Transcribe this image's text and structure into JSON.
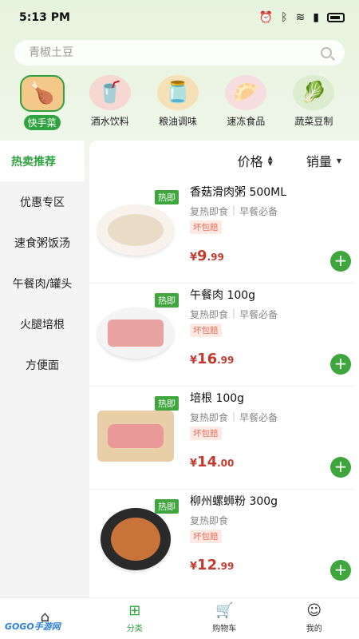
{
  "status_bar": {
    "time": "5:13 PM"
  },
  "search": {
    "placeholder": "青椒土豆"
  },
  "categories": [
    {
      "label": "快手菜",
      "icon": "fried-food-icon"
    },
    {
      "label": "酒水饮料",
      "icon": "cola-icon"
    },
    {
      "label": "粮油调味",
      "icon": "oil-bottle-icon"
    },
    {
      "label": "速冻食品",
      "icon": "dumpling-icon"
    },
    {
      "label": "蔬菜豆制",
      "icon": "vegetable-icon"
    }
  ],
  "sidebar": {
    "items": [
      {
        "label": "热卖推荐"
      },
      {
        "label": "优惠专区"
      },
      {
        "label": "速食粥饭汤"
      },
      {
        "label": "午餐肉/罐头"
      },
      {
        "label": "火腿培根"
      },
      {
        "label": "方便面"
      }
    ]
  },
  "sort": {
    "price_label": "价格",
    "sales_label": "销量"
  },
  "products": [
    {
      "name": "香菇滑肉粥 500ML",
      "hot": "热即",
      "tag1": "复热即食",
      "tag2": "早餐必备",
      "badge": "坏包赔",
      "currency": "¥",
      "price_int": "9",
      "price_dec": ".99"
    },
    {
      "name": "午餐肉 100g",
      "hot": "热即",
      "tag1": "复热即食",
      "tag2": "早餐必备",
      "badge": "坏包赔",
      "currency": "¥",
      "price_int": "16",
      "price_dec": ".99"
    },
    {
      "name": "培根 100g",
      "hot": "热即",
      "tag1": "复热即食",
      "tag2": "早餐必备",
      "badge": "坏包赔",
      "currency": "¥",
      "price_int": "14",
      "price_dec": ".00"
    },
    {
      "name": "柳州螺蛳粉 300g",
      "hot": "热即",
      "tag1": "复热即食",
      "tag2": "",
      "badge": "坏包赔",
      "currency": "¥",
      "price_int": "12",
      "price_dec": ".99"
    }
  ],
  "tabbar": {
    "home": "",
    "category": "分类",
    "cart": "购物车",
    "mine": "我的"
  },
  "watermark": "GOGO手游网",
  "colors": {
    "accent": "#2fa33f",
    "price": "#c33a2e",
    "badge": "#e86b56"
  }
}
